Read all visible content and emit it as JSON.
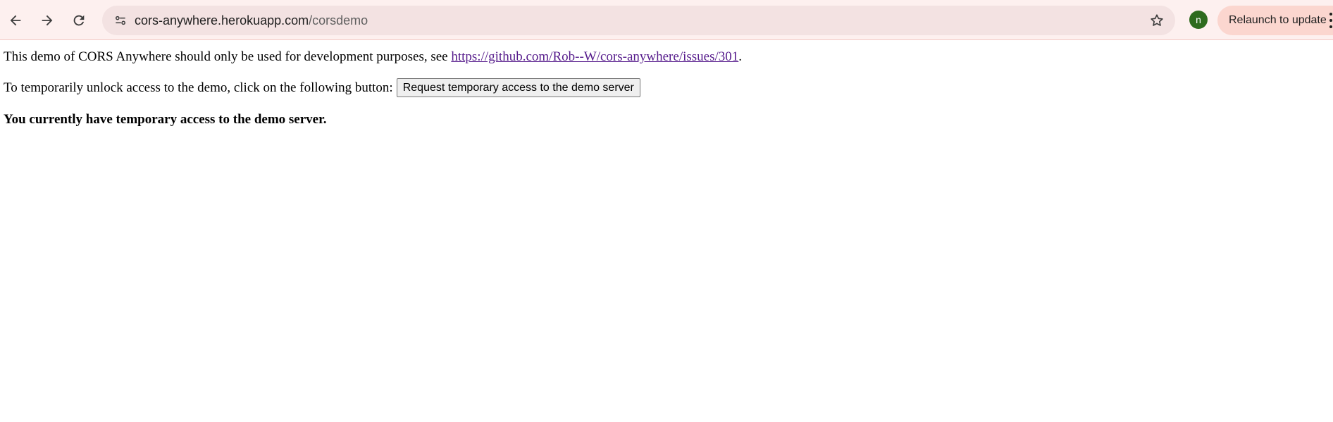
{
  "browser": {
    "url_host": "cors-anywhere.herokuapp.com",
    "url_path": "/corsdemo",
    "profile_initial": "n",
    "relaunch_label": "Relaunch to update",
    "icons": [
      "back-arrow-icon",
      "forward-arrow-icon",
      "reload-icon",
      "site-info-icon",
      "bookmark-star-icon",
      "more-menu-icon"
    ]
  },
  "page": {
    "intro_text": "This demo of CORS Anywhere should only be used for development purposes, see ",
    "intro_link": "https://github.com/Rob--W/cors-anywhere/issues/301",
    "intro_end": ".",
    "unlock_text": "To temporarily unlock access to the demo, click on the following button:",
    "request_button": "Request temporary access to the demo server",
    "status_text": "You currently have temporary access to the demo server."
  },
  "colors": {
    "toolbar_bg": "#fdf0ef",
    "omnibox_bg": "#f3e2e2",
    "relaunch_bg": "#fbd6cf",
    "avatar_bg": "#2e6b1e",
    "link_visited": "#551a8b"
  }
}
